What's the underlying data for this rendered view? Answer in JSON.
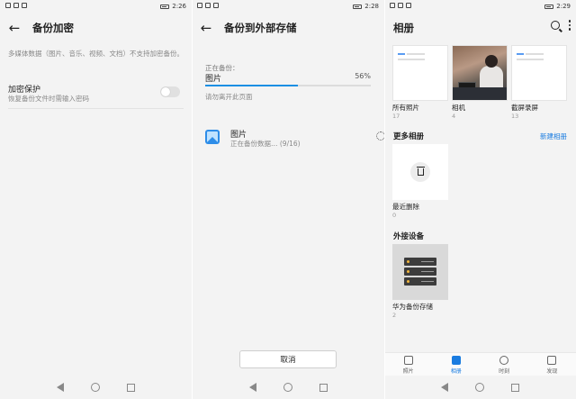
{
  "panel1": {
    "status_time": "2:26",
    "title": "备份加密",
    "note": "多媒体数据（图片、音乐、视频、文档）不支持加密备份。",
    "encrypt_title": "加密保护",
    "encrypt_sub": "恢复备份文件时需输入密码",
    "toggle_on": false
  },
  "panel2": {
    "status_time": "2:28",
    "title": "备份到外部存储",
    "backing_label": "正在备份：",
    "backing_item": "图片",
    "percent": "56%",
    "progress": 0.56,
    "warning": "请勿离开此页面",
    "row_title": "图片",
    "row_sub": "正在备份数据… (9/16)",
    "cancel_label": "取消",
    "accent": "#1a8fe3"
  },
  "panel3": {
    "status_time": "2:29",
    "title": "相册",
    "albums": [
      {
        "name": "所有照片",
        "count": "17"
      },
      {
        "name": "相机",
        "count": "4"
      },
      {
        "name": "截屏录屏",
        "count": "13"
      }
    ],
    "more_section": "更多相册",
    "new_album": "新建相册",
    "recent_deleted": {
      "name": "最近删除",
      "count": "0"
    },
    "external_section": "外接设备",
    "external_device": {
      "name": "华为备份存储",
      "count": "2"
    },
    "tabs": [
      {
        "label": "照片",
        "active": false
      },
      {
        "label": "相册",
        "active": true
      },
      {
        "label": "时刻",
        "active": false
      },
      {
        "label": "发现",
        "active": false
      }
    ],
    "accent": "#1a7ce0"
  }
}
